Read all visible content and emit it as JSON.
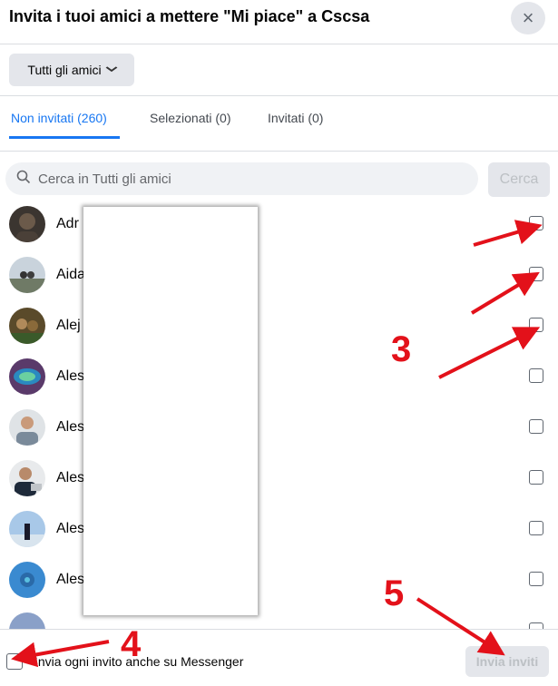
{
  "dialog": {
    "title": "Invita i tuoi amici a mettere \"Mi piace\" a Cscsa",
    "close_icon": "×"
  },
  "filter": {
    "label": "Tutti gli amici",
    "chevron": "⌄"
  },
  "tabs": [
    {
      "label": "Non invitati (260)"
    },
    {
      "label": "Selezionati (0)"
    },
    {
      "label": "Invitati (0)"
    }
  ],
  "search": {
    "placeholder": "Cerca in Tutti gli amici",
    "button": "Cerca"
  },
  "friends": [
    {
      "name": "Adr"
    },
    {
      "name": "Aida"
    },
    {
      "name": "Alej"
    },
    {
      "name": "Ales"
    },
    {
      "name": "Ales"
    },
    {
      "name": "Ales"
    },
    {
      "name": "Ales"
    },
    {
      "name": "Ales"
    }
  ],
  "footer": {
    "messenger_label": "Invia ogni invito anche su Messenger",
    "send_button": "Invia inviti"
  },
  "annotations": {
    "step3": "3",
    "step4": "4",
    "step5": "5"
  },
  "colors": {
    "accent": "#1877f2",
    "annotation": "#e3111a"
  }
}
